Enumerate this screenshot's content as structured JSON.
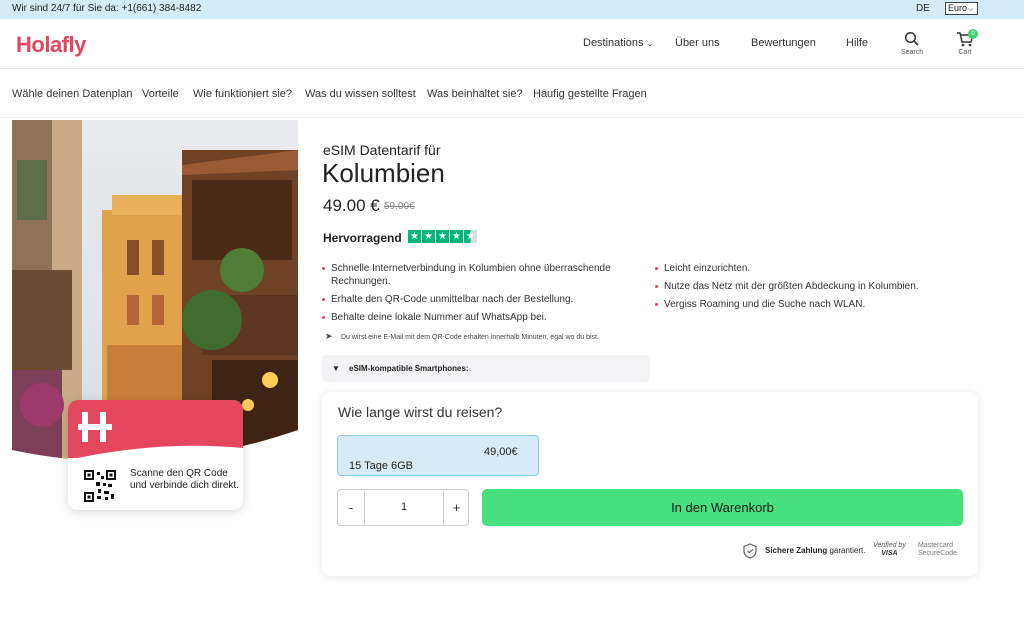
{
  "topbar": {
    "contact": "Wir sind 24/7 für Sie da: +1(661) 384-8482",
    "language": "DE",
    "currency": "Euro"
  },
  "header": {
    "logo": "Holafly",
    "nav": [
      "Destinations",
      "Über uns",
      "Bewertungen",
      "Hilfe"
    ],
    "search_label": "Search",
    "cart_label": "Cart",
    "cart_count": "0"
  },
  "subnav": [
    "Wähle deinen Datenplan",
    "Vorteile",
    "Wie funktioniert sie?",
    "Was du wissen solltest",
    "Was beinhaltet sie?",
    "Häufig gestellte Fragen"
  ],
  "card": {
    "text": "Scanne den QR Code und verbinde dich direkt."
  },
  "product": {
    "subtitle": "eSIM Datentarif für",
    "title": "Kolumbien",
    "price": "49.00 €",
    "old_price": "59.00€",
    "rating_label": "Hervorragend",
    "rating_stars": 4.5,
    "features_left": [
      "Schnelle Internetverbindung in Kolumbien ohne überraschende Rechnungen.",
      "Erhalte den QR-Code unmittelbar nach der Bestellung.",
      "Behalte deine lokale Nummer auf WhatsApp bei."
    ],
    "features_right": [
      "Leicht einzurichten.",
      "Nutze das Netz mit der größten Abdeckung in Kolumbien.",
      "Vergiss Roaming und die Suche nach WLAN."
    ],
    "note": "Du wirst eine E-Mail mit dem QR-Code erhalten innerhalb Minuten, egal wo du bist.",
    "compat_label": "eSIM-kompatible Smartphones:"
  },
  "buybox": {
    "question": "Wie lange wirst du reisen?",
    "plan_price": "49,00€",
    "plan_name": "15 Tage 6GB",
    "qty_minus": "-",
    "qty_value": "1",
    "qty_plus": "+",
    "cart_button": "In den Warenkorb",
    "secure_bold": "Sichere Zahlung",
    "secure_rest": " garantiert.",
    "visa_line1": "Verified by",
    "visa_line2": "VISA",
    "mc_line1": "Mastercard",
    "mc_line2": "SecureCode"
  },
  "colors": {
    "brand": "#e2475d",
    "accent_green": "#47e07e",
    "topbar_bg": "#d3ecf9",
    "plan_bg": "#d5ecf8",
    "trustpilot": "#00b67a"
  }
}
